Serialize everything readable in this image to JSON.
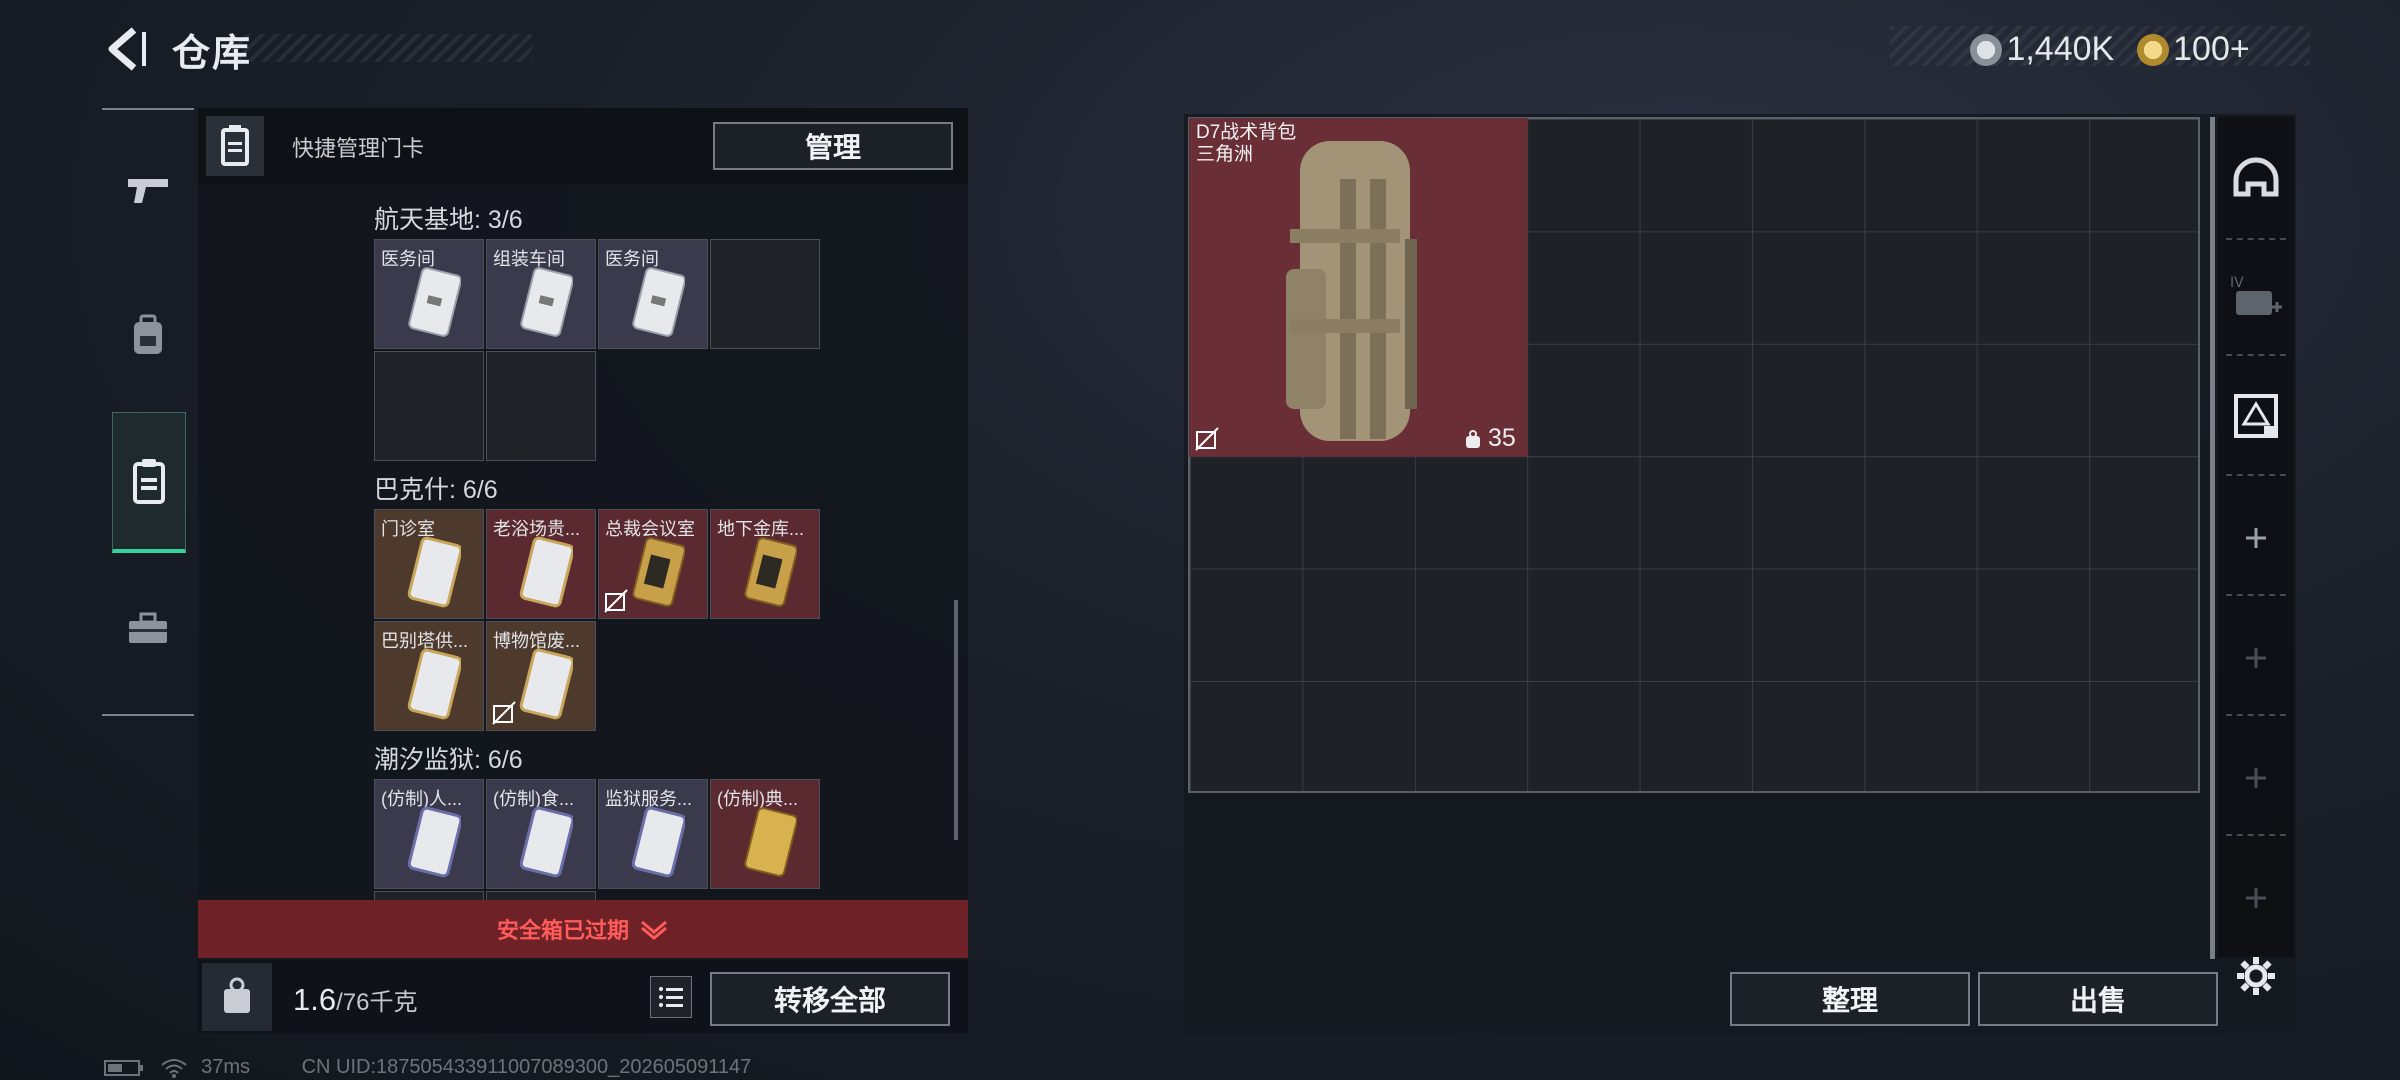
{
  "header": {
    "title": "仓库"
  },
  "currency": {
    "silver": "1,440K",
    "gold": "100+"
  },
  "nav": {
    "tabs": [
      "weapons",
      "equipment",
      "keycards",
      "tools"
    ],
    "active": "keycards"
  },
  "inventory": {
    "header_label": "快捷管理门卡",
    "manage_label": "管理",
    "sections": [
      {
        "label": "航天基地: 3/6",
        "cards": [
          "医务间",
          "组装车间",
          "医务间"
        ]
      },
      {
        "label": "巴克什: 6/6",
        "cards": [
          "门诊室",
          "老浴场贵...",
          "总裁会议室",
          "地下金库...",
          "巴别塔供...",
          "博物馆废..."
        ]
      },
      {
        "label": "潮汐监狱: 6/6",
        "cards": [
          "(仿制)人...",
          "(仿制)食...",
          "监狱服务...",
          "(仿制)典..."
        ]
      }
    ],
    "expired_label": "安全箱已过期",
    "weight_value": "1.6",
    "weight_max": "/76千克",
    "transfer_all_label": "转移全部"
  },
  "backpack": {
    "item_name_line1": "D7战术背包",
    "item_name_line2": "三角洲",
    "item_count": "35",
    "sort_label": "整理",
    "sell_label": "出售"
  },
  "status_bar": {
    "ping": "37ms",
    "uid": "CN UID:187505433911007089300_202605091147"
  },
  "colors": {
    "accent": "#35d39a",
    "expired": "#ff5b5b",
    "item_bg": "#6a2e36"
  }
}
